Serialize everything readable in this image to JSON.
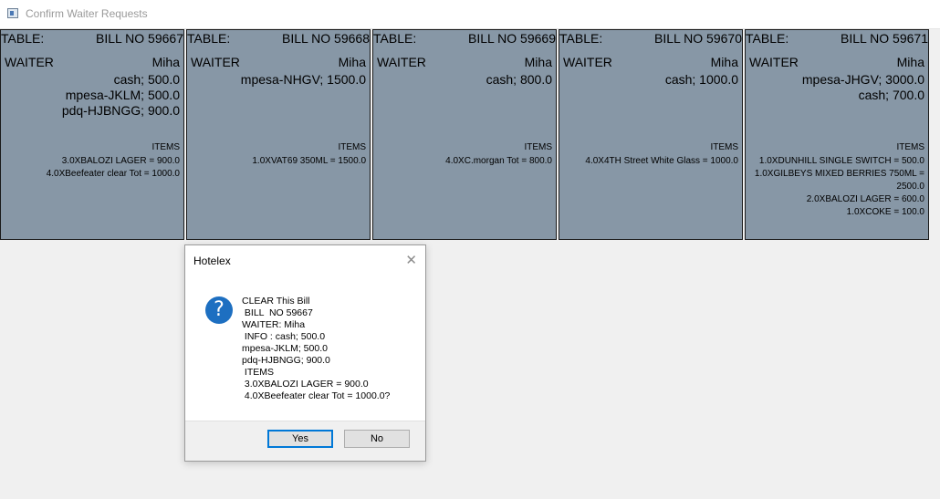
{
  "window": {
    "title": "Confirm Waiter Requests",
    "icon": "window-icon"
  },
  "cards": [
    {
      "table_label": "TABLE:",
      "bill": "BILL  NO 59667",
      "waiter_label": "WAITER",
      "waiter_name": "Miha",
      "payments": [
        "cash; 500.0",
        "mpesa-JKLM; 500.0",
        "pdq-HJBNGG; 900.0"
      ],
      "items_label": "ITEMS",
      "items": [
        "3.0XBALOZI LAGER = 900.0",
        "4.0XBeefeater clear Tot = 1000.0"
      ]
    },
    {
      "table_label": "TABLE:",
      "bill": "BILL  NO 59668",
      "waiter_label": "WAITER",
      "waiter_name": "Miha",
      "payments": [
        "mpesa-NHGV; 1500.0"
      ],
      "items_label": "ITEMS",
      "items": [
        "1.0XVAT69 350ML = 1500.0"
      ]
    },
    {
      "table_label": "TABLE:",
      "bill": "BILL  NO 59669",
      "waiter_label": "WAITER",
      "waiter_name": "Miha",
      "payments": [
        "cash; 800.0"
      ],
      "items_label": "ITEMS",
      "items": [
        "4.0XC.morgan Tot = 800.0"
      ]
    },
    {
      "table_label": "TABLE:",
      "bill": "BILL  NO 59670",
      "waiter_label": "WAITER",
      "waiter_name": "Miha",
      "payments": [
        "cash; 1000.0"
      ],
      "items_label": "ITEMS",
      "items": [
        "4.0X4TH Street White Glass = 1000.0"
      ]
    },
    {
      "table_label": "TABLE:",
      "bill": "BILL  NO 59671",
      "waiter_label": "WAITER",
      "waiter_name": "Miha",
      "payments": [
        "mpesa-JHGV; 3000.0",
        "cash; 700.0"
      ],
      "items_label": "ITEMS",
      "items": [
        "1.0XDUNHILL SINGLE SWITCH = 500.0",
        "1.0XGILBEYS MIXED BERRIES 750ML =",
        "2500.0",
        "2.0XBALOZI LAGER = 600.0",
        "1.0XCOKE = 100.0"
      ]
    }
  ],
  "dialog": {
    "title": "Hotelex",
    "close_symbol": "✕",
    "icon_glyph": "?",
    "message": "CLEAR This Bill\n BILL  NO 59667\nWAITER: Miha\n INFO : cash; 500.0\nmpesa-JKLM; 500.0\npdq-HJBNGG; 900.0\n ITEMS\n 3.0XBALOZI LAGER = 900.0\n 4.0XBeefeater clear Tot = 1000.0?",
    "yes_label": "Yes",
    "no_label": "No"
  }
}
